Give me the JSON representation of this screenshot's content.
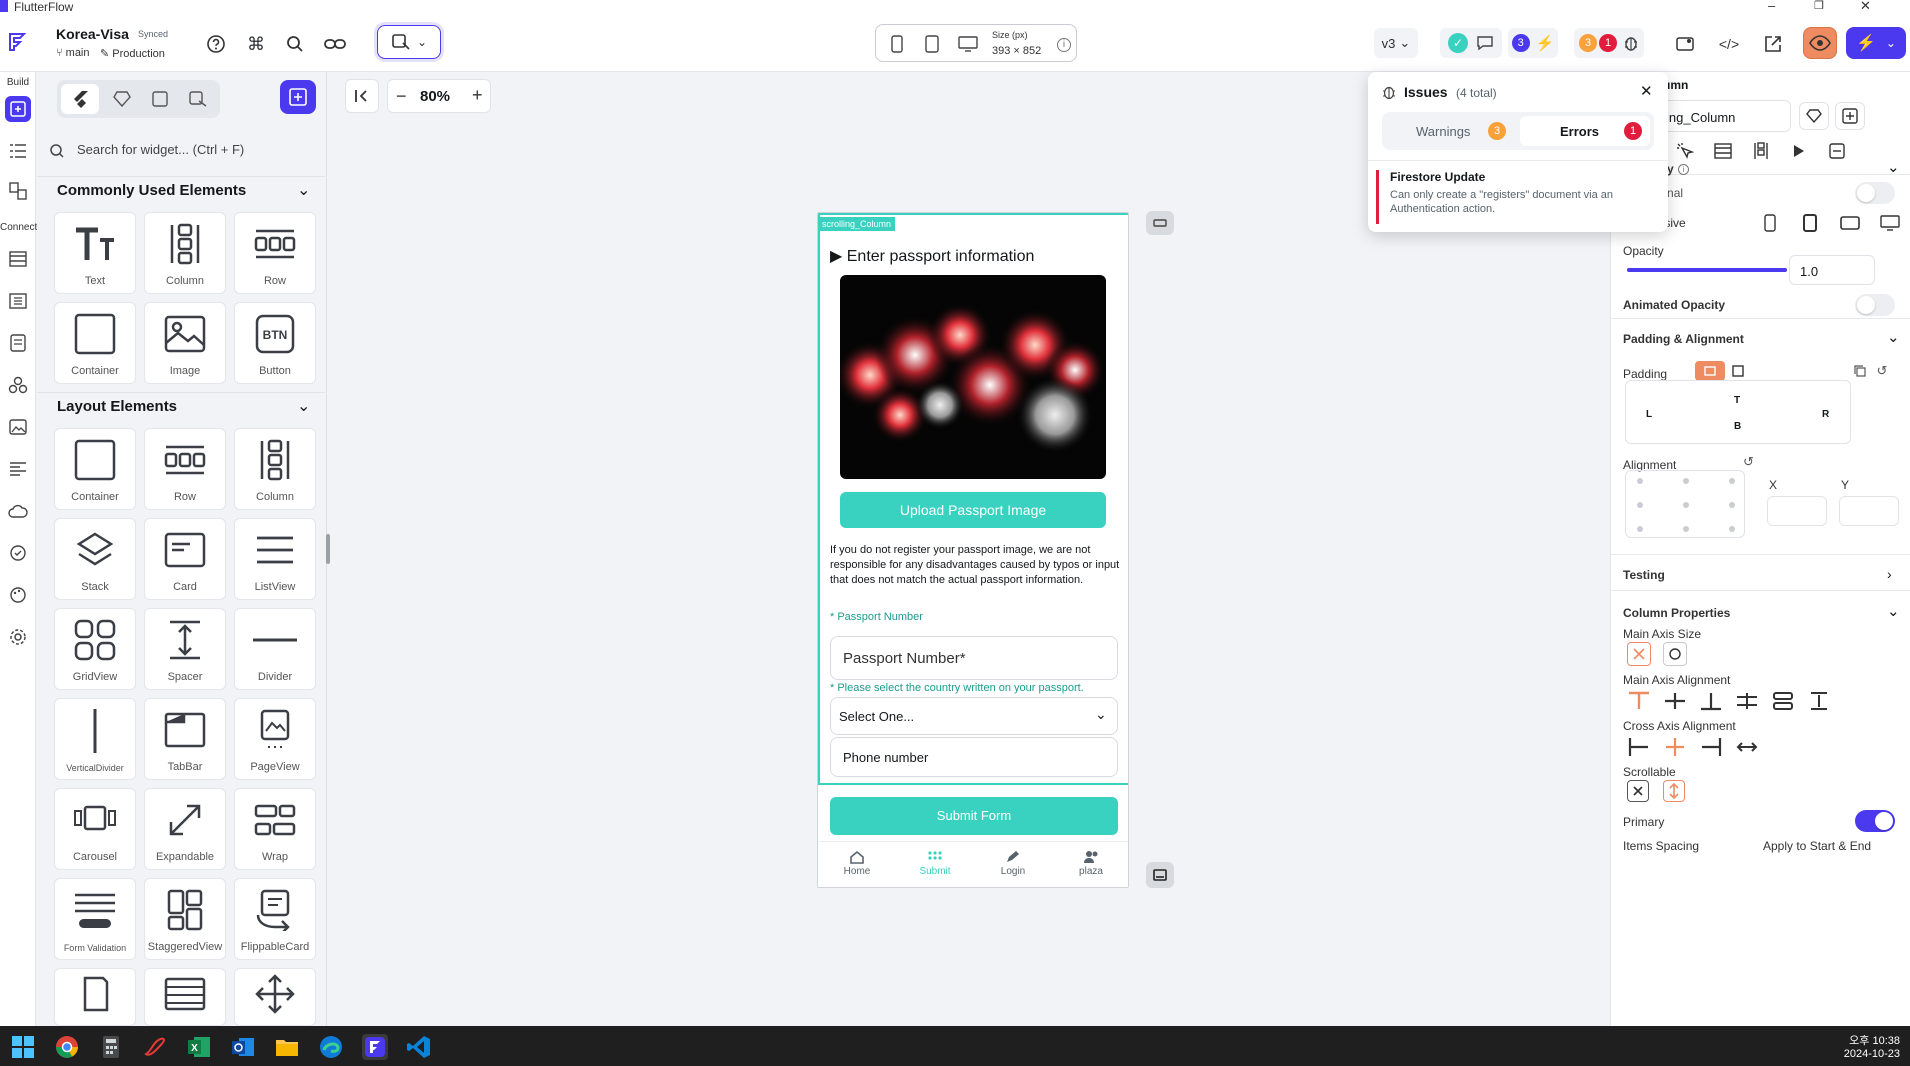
{
  "app_title": "FlutterFlow",
  "project": {
    "name": "Korea-Visa",
    "sync_status": "Synced",
    "branch": "main",
    "environment": "Production"
  },
  "device": {
    "size_label": "Size (px)",
    "size_value": "393 × 852"
  },
  "toolbar": {
    "version": "v3",
    "badge_blue": "3",
    "badge_orange": "3",
    "badge_red": "1"
  },
  "left_rail": {
    "build_label": "Build",
    "connect_label": "Connect"
  },
  "widget_panel": {
    "search_placeholder": "Search for widget... (Ctrl + F)",
    "common_title": "Commonly Used Elements",
    "common_items": [
      "Text",
      "Column",
      "Row",
      "Container",
      "Image",
      "Button"
    ],
    "layout_title": "Layout Elements",
    "layout_items": [
      "Container",
      "Row",
      "Column",
      "Stack",
      "Card",
      "ListView",
      "GridView",
      "Spacer",
      "Divider",
      "VerticalDivider",
      "TabBar",
      "PageView",
      "Carousel",
      "Expandable",
      "Wrap",
      "Form Validation",
      "StaggeredView",
      "FlippableCard"
    ]
  },
  "canvas": {
    "zoom": "80%"
  },
  "phone": {
    "widget_tag": "scrolling_Column",
    "section_title": "▶ Enter passport information",
    "upload_button": "Upload Passport Image",
    "disclaimer": "If you do not register your passport image, we are not responsible for any disadvantages caused by typos or input that does not match the actual passport information.",
    "passport_label": "* Passport Number",
    "passport_placeholder": "Passport Number*",
    "country_label": "* Please select the country written on your passport.",
    "country_select": "Select One...",
    "phone_placeholder": "Phone number",
    "submit_button": "Submit Form",
    "nav": [
      "Home",
      "Submit",
      "Login",
      "plaza"
    ]
  },
  "issues": {
    "title": "Issues",
    "total": "(4 total)",
    "warnings_tab": "Warnings",
    "warnings_count": "3",
    "errors_tab": "Errors",
    "errors_count": "1",
    "item_title": "Firestore Update",
    "item_body": "Can only create a \"registers\" document via an Authentication action."
  },
  "properties": {
    "header_partial": "umn",
    "name_field": "ing_Column",
    "visibility_partial": "y",
    "conditional": "Conditional",
    "responsive": "Responsive",
    "opacity": "Opacity",
    "opacity_value": "1.0",
    "animated_opacity": "Animated Opacity",
    "padding_alignment": "Padding & Alignment",
    "padding": "Padding",
    "pad_t": "T",
    "pad_l": "L",
    "pad_r": "R",
    "pad_b": "B",
    "alignment": "Alignment",
    "align_x": "X",
    "align_y": "Y",
    "testing": "Testing",
    "column_properties": "Column Properties",
    "main_axis_size": "Main Axis Size",
    "main_axis_alignment": "Main Axis Alignment",
    "cross_axis_alignment": "Cross Axis Alignment",
    "scrollable": "Scrollable",
    "primary": "Primary",
    "items_spacing": "Items Spacing",
    "apply_start_end": "Apply to Start & End"
  },
  "taskbar": {
    "time": "오후 10:38",
    "date": "2024-10-23"
  },
  "colors": {
    "accent": "#4b39ef",
    "teal": "#39d2c0",
    "orange": "#ee8b60",
    "error": "#e21c3d",
    "warning": "#f9a13b"
  }
}
